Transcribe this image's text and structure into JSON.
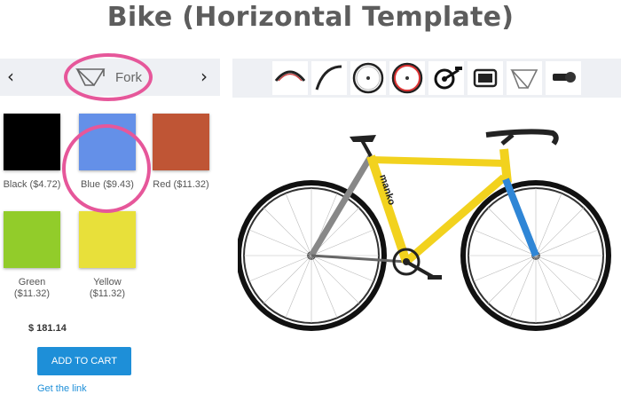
{
  "page": {
    "title": "Bike (Horizontal Template)"
  },
  "part_selector": {
    "current": "Fork",
    "prev_arrow": "‹",
    "next_arrow": "›"
  },
  "colors": [
    {
      "label": "Black ($4.72)",
      "hex": "#000000"
    },
    {
      "label": "Blue ($9.43)",
      "hex": "#6490e8"
    },
    {
      "label": "Red ($11.32)",
      "hex": "#bf5535"
    },
    {
      "label": "Green ($11.32)",
      "hex": "#92cc2a"
    },
    {
      "label": "Yellow ($11.32)",
      "hex": "#e8e03a"
    }
  ],
  "cart": {
    "price": "$ 181.14",
    "button": "ADD TO CART",
    "link": "Get the link"
  },
  "thumbnails": [
    "rim-icon",
    "tire-icon",
    "front-wheel-icon",
    "rear-wheel-icon",
    "crankset-icon",
    "saddle-icon",
    "frame-icon",
    "stem-icon"
  ],
  "bike": {
    "frame_color": "#f2d21e",
    "fork_color": "#2f86d6",
    "brand": "manko"
  },
  "accent": {
    "highlight": "#e6579a",
    "button": "#1e8fd8"
  }
}
